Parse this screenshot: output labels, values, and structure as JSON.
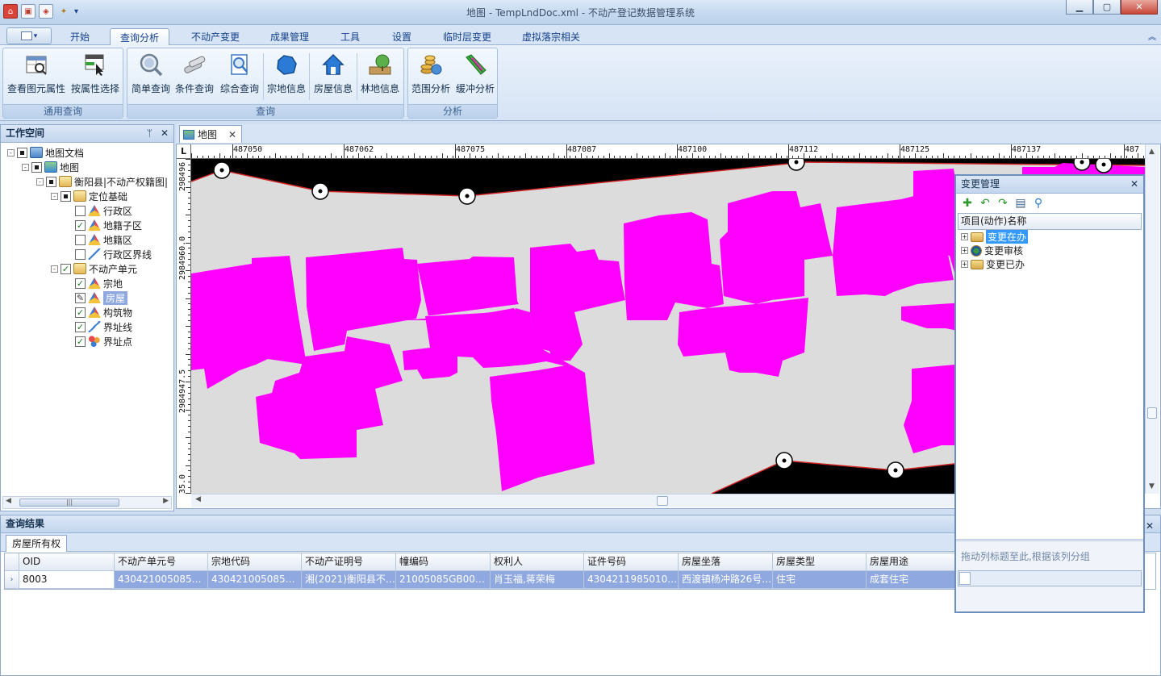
{
  "window": {
    "title": "地图 - TempLndDoc.xml - 不动产登记数据管理系统",
    "minimize_glyph": "▁",
    "maximize_glyph": "▢",
    "close_glyph": "✕",
    "qat_dropdown": "▾"
  },
  "ribbon": {
    "tabs": [
      "开始",
      "查询分析",
      "不动产变更",
      "成果管理",
      "工具",
      "设置",
      "临时层变更",
      "虚拟落宗相关"
    ],
    "active_tab": "查询分析",
    "collapse_glyph": "︽",
    "groups": [
      {
        "label": "通用查询",
        "buttons": [
          "查看图元属性",
          "按属性选择"
        ]
      },
      {
        "label": "查询",
        "buttons": [
          "简单查询",
          "条件查询",
          "综合查询",
          "宗地信息",
          "房屋信息",
          "林地信息"
        ]
      },
      {
        "label": "分析",
        "buttons": [
          "范围分析",
          "缓冲分析"
        ]
      }
    ]
  },
  "workspace": {
    "title": "工作空间",
    "pin_glyph": "ᛘ",
    "close_glyph": "✕",
    "tree": [
      {
        "label": "地图文档",
        "level": 0,
        "expand": "-",
        "check": "partial",
        "icon": "map-document-icon"
      },
      {
        "label": "地图",
        "level": 1,
        "expand": "-",
        "check": "partial",
        "icon": "map-icon"
      },
      {
        "label": "衡阳县|不动产权籍图|",
        "level": 2,
        "expand": "-",
        "check": "partial",
        "icon": "folder-icon"
      },
      {
        "label": "定位基础",
        "level": 3,
        "expand": "-",
        "check": "partial",
        "icon": "folder-icon"
      },
      {
        "label": "行政区",
        "level": 4,
        "expand": "",
        "check": "none",
        "icon": "polygon-layer-icon"
      },
      {
        "label": "地籍子区",
        "level": 4,
        "expand": "",
        "check": "checked",
        "icon": "polygon-layer-icon"
      },
      {
        "label": "地籍区",
        "level": 4,
        "expand": "",
        "check": "none",
        "icon": "polygon-layer-icon"
      },
      {
        "label": "行政区界线",
        "level": 4,
        "expand": "",
        "check": "none",
        "icon": "line-layer-icon"
      },
      {
        "label": "不动产单元",
        "level": 3,
        "expand": "-",
        "check": "checked",
        "icon": "folder-icon"
      },
      {
        "label": "宗地",
        "level": 4,
        "expand": "",
        "check": "checked",
        "icon": "polygon-layer-icon"
      },
      {
        "label": "房屋",
        "level": 4,
        "expand": "",
        "check": "edit",
        "icon": "polygon-layer-icon",
        "selected": true
      },
      {
        "label": "构筑物",
        "level": 4,
        "expand": "",
        "check": "checked",
        "icon": "polygon-layer-icon"
      },
      {
        "label": "界址线",
        "level": 4,
        "expand": "",
        "check": "checked",
        "icon": "line-layer-icon"
      },
      {
        "label": "界址点",
        "level": 4,
        "expand": "",
        "check": "checked",
        "icon": "point-layer-icon"
      }
    ],
    "scroll_grip": "|||"
  },
  "map": {
    "tab_label": "地图",
    "tab_close": "✕",
    "ruler_corner": "L",
    "ruler_x_labels": [
      "487050",
      "487062",
      "487075",
      "487087",
      "487100",
      "487112",
      "487125",
      "487137",
      "487"
    ],
    "ruler_y_labels": [
      "298496",
      "2984960.0",
      "2984947.5",
      "35.0"
    ],
    "colors": {
      "building": "#ff00ff",
      "parcel_background": "#dcdcdc",
      "road_area": "#000000",
      "boundary_line": "#d22424"
    }
  },
  "change_management": {
    "title": "变更管理",
    "close_glyph": "✕",
    "toolbar_icons": [
      "add-icon",
      "undo-icon",
      "redo-icon",
      "save-icon",
      "search-icon"
    ],
    "column_header": "项目(动作)名称",
    "nodes": [
      {
        "label": "变更在办",
        "selected": true
      },
      {
        "label": "变更审核",
        "selected": false
      },
      {
        "label": "变更已办",
        "selected": false
      }
    ],
    "group_hint": "拖动列标题至此,根据该列分组"
  },
  "query_results": {
    "title": "查询结果",
    "close_glyph": "✕",
    "tab": "房屋所有权",
    "columns": [
      "OID",
      "不动产单元号",
      "宗地代码",
      "不动产证明号",
      "幢编码",
      "权利人",
      "证件号码",
      "房屋坐落",
      "房屋类型",
      "房屋用途"
    ],
    "rows": [
      [
        "8003",
        "430421005085GB…",
        "430421005085GB…",
        "湘(2021)衡阳县不…",
        "21005085GB0010…",
        "肖玉福,蒋荣梅",
        "43042119850104…",
        "西渡镇杨冲路26号…",
        "住宅",
        "成套住宅"
      ]
    ],
    "row_indicator": "›"
  }
}
